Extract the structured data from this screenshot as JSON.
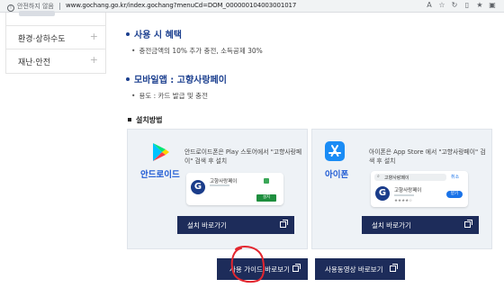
{
  "browser": {
    "security_warning": "안전하지 않음",
    "url": "www.gochang.go.kr/index.gochang?menuCd=DOM_000000104003001017"
  },
  "sidebar": {
    "items": [
      {
        "label": "환경·상하수도"
      },
      {
        "label": "재난·안전"
      }
    ]
  },
  "usage": {
    "title": "사용 시 혜택",
    "bullet": "충전금액의 10% 추가 충전, 소득공제 30%"
  },
  "mobile_app": {
    "title": "모바일앱 : 고향사랑페이",
    "bullet": "용도 : 카드 발급 및 충전"
  },
  "install": {
    "title": "설치방법",
    "android": {
      "platform": "안드로이드",
      "desc": "안드로이드폰은 Play 스토어에서 \"고향사랑페이\" 검색 후 설치",
      "app_name": "고향사랑페이",
      "install_label": "설치",
      "button": "설치 바로가기"
    },
    "ios": {
      "platform": "아이폰",
      "desc": "아이폰은 App Store 에서 \"고향사랑페이\" 검색 후 설치",
      "search_text": "고향사랑페이",
      "cancel_label": "취소",
      "app_name": "고향사랑페이",
      "get_label": "받기",
      "button": "설치 바로가기"
    }
  },
  "buttons": {
    "guide": "사용 가이드 바로보기",
    "video": "사용동영상 바로보기"
  },
  "colors": {
    "accent": "#1b3f8f",
    "button_bg": "#1d2c5a",
    "platform_text": "#1f5bd4",
    "annotation": "#e3262f"
  }
}
